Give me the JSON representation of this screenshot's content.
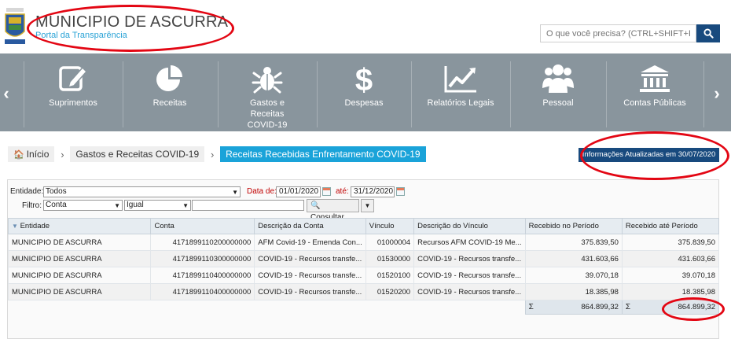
{
  "header": {
    "title": "MUNICIPIO DE ASCURRA",
    "subtitle": "Portal da Transparência",
    "search_placeholder": "O que você precisa? (CTRL+SHIFT+F)"
  },
  "nav": {
    "items": [
      {
        "label": "Suprimentos",
        "icon": "edit-icon"
      },
      {
        "label": "Receitas",
        "icon": "pie-chart-icon"
      },
      {
        "label": "Gastos e Receitas COVID-19",
        "icon": "bug-icon"
      },
      {
        "label": "Despesas",
        "icon": "dollar-icon"
      },
      {
        "label": "Relatórios Legais",
        "icon": "line-chart-icon"
      },
      {
        "label": "Pessoal",
        "icon": "users-icon"
      },
      {
        "label": "Contas Públicas",
        "icon": "bank-icon"
      }
    ]
  },
  "breadcrumb": {
    "home": "Início",
    "level1": "Gastos e Receitas COVID-19",
    "current": "Receitas Recebidas Enfrentamento COVID-19"
  },
  "updated_badge": "Informações Atualizadas em 30/07/2020",
  "filters": {
    "entidade_label": "Entidade:",
    "entidade_value": "Todos",
    "data_de_label": "Data de:",
    "data_de_value": "01/01/2020",
    "ate_label": "até:",
    "ate_value": "31/12/2020",
    "filtro_label": "Filtro:",
    "campo_value": "Conta",
    "operador_value": "Igual",
    "texto_value": "",
    "consultar_label": "Consultar"
  },
  "table": {
    "columns": [
      "Entidade",
      "Conta",
      "Descrição da Conta",
      "Vínculo",
      "Descrição do Vínculo",
      "Recebido no Período",
      "Recebido até Período"
    ],
    "rows": [
      [
        "MUNICIPIO DE ASCURRA",
        "4171899110200000000",
        "AFM Covid-19 - Emenda Con...",
        "01000004",
        "Recursos AFM COVID-19 Me...",
        "375.839,50",
        "375.839,50"
      ],
      [
        "MUNICIPIO DE ASCURRA",
        "4171899110300000000",
        "COVID-19 - Recursos transfe...",
        "01530000",
        "COVID-19 - Recursos transfe...",
        "431.603,66",
        "431.603,66"
      ],
      [
        "MUNICIPIO DE ASCURRA",
        "4171899110400000000",
        "COVID-19 - Recursos transfe...",
        "01520100",
        "COVID-19 - Recursos transfe...",
        "39.070,18",
        "39.070,18"
      ],
      [
        "MUNICIPIO DE ASCURRA",
        "4171899110400000000",
        "COVID-19 - Recursos transfe...",
        "01520200",
        "COVID-19 - Recursos transfe...",
        "18.385,98",
        "18.385,98"
      ]
    ],
    "totals": {
      "sigma": "Σ",
      "recebido_periodo": "864.899,32",
      "recebido_ate": "864.899,32"
    }
  }
}
